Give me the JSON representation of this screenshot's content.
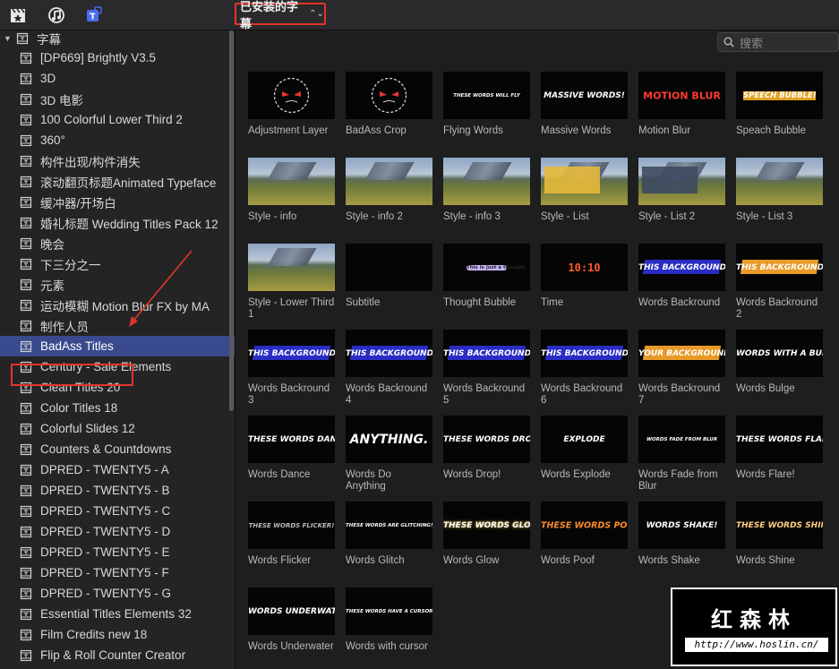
{
  "toolbar": {
    "icons": [
      "clapper-icon",
      "music-note-icon",
      "titles-icon"
    ],
    "library_label": "已安装的字幕",
    "chevron": "⌃⌄"
  },
  "search": {
    "placeholder": "搜索"
  },
  "sidebar": {
    "root": "字幕",
    "items": [
      "[DP669] Brightly V3.5",
      "3D",
      "3D 电影",
      "100 Colorful Lower Third 2",
      "360°",
      "构件出现/构件消失",
      "滚动翻页标题Animated Typeface",
      "缓冲器/开场白",
      "婚礼标题 Wedding Titles Pack 12",
      "晚会",
      "下三分之一",
      "元素",
      "运动模糊 Motion Blur FX by MA",
      "制作人员",
      "BadAss Titles",
      "Century - Sale Elements",
      "Clean Titles 20",
      "Color Titles 18",
      "Colorful Slides 12",
      "Counters & Countdowns",
      "DPRED - TWENTY5 - A",
      "DPRED - TWENTY5 - B",
      "DPRED - TWENTY5 - C",
      "DPRED - TWENTY5 - D",
      "DPRED - TWENTY5 - E",
      "DPRED - TWENTY5 - F",
      "DPRED - TWENTY5 - G",
      "Essential Titles Elements 32",
      "Film Credits new 18",
      "Flip & Roll Counter Creator"
    ],
    "selected_index": 14
  },
  "grid": {
    "items": [
      {
        "label": "Adjustment Layer",
        "thumb": ""
      },
      {
        "label": "BadAss Crop",
        "thumb": ""
      },
      {
        "label": "Flying Words",
        "thumb": "THESE  WORDS  WILL  FLY"
      },
      {
        "label": "Massive Words",
        "thumb": "MASSIVE WORDS!"
      },
      {
        "label": "Motion Blur",
        "thumb": "MOTION BLUR"
      },
      {
        "label": "Speach Bubble",
        "thumb": "SPEECH BUBBLE!"
      },
      {
        "label": "Style - info",
        "thumb": ""
      },
      {
        "label": "Style - info 2",
        "thumb": ""
      },
      {
        "label": "Style - info 3",
        "thumb": ""
      },
      {
        "label": "Style - List",
        "thumb": ""
      },
      {
        "label": "Style - List 2",
        "thumb": ""
      },
      {
        "label": "Style - List 3",
        "thumb": ""
      },
      {
        "label": "Style - Lower Third 1",
        "thumb": ""
      },
      {
        "label": "Subtitle",
        "thumb": ""
      },
      {
        "label": "Thought Bubble",
        "thumb": "This is just a thought"
      },
      {
        "label": "Time",
        "thumb": "10:10"
      },
      {
        "label": "Words Backround",
        "thumb": "THIS BACKGROUND"
      },
      {
        "label": "Words Backround 2",
        "thumb": "THIS BACKGROUND"
      },
      {
        "label": "Words Backround 3",
        "thumb": "THIS BACKGROUND"
      },
      {
        "label": "Words Backround 4",
        "thumb": "THIS BACKGROUNDS"
      },
      {
        "label": "Words Backround 5",
        "thumb": "THIS BACKGROUND"
      },
      {
        "label": "Words Backround 6",
        "thumb": "THIS BACKGROUND"
      },
      {
        "label": "Words Backround 7",
        "thumb": "YOUR BACKGROUND"
      },
      {
        "label": "Words Bulge",
        "thumb": "WORDS WITH A BUMP"
      },
      {
        "label": "Words Dance",
        "thumb": "THESE WORDS DANCE!"
      },
      {
        "label": "Words Do Anything",
        "thumb": "ANYTHING."
      },
      {
        "label": "Words Drop!",
        "thumb": "THESE WORDS DROP!"
      },
      {
        "label": "Words Explode",
        "thumb": "EXPLODE"
      },
      {
        "label": "Words Fade from Blur",
        "thumb": "WORDS FADE FROM BLUR"
      },
      {
        "label": "Words Flare!",
        "thumb": "THESE WORDS FLARE"
      },
      {
        "label": "Words Flicker",
        "thumb": "THESE WORDS FLICKER!"
      },
      {
        "label": "Words Glitch",
        "thumb": "THESE WORDS ARE GLITCHING!"
      },
      {
        "label": "Words Glow",
        "thumb": "THESE WORDS GLOW!"
      },
      {
        "label": "Words Poof",
        "thumb": "THESE WORDS POOF!"
      },
      {
        "label": "Words Shake",
        "thumb": "WORDS SHAKE!"
      },
      {
        "label": "Words Shine",
        "thumb": "THESE WORDS SHINE!"
      },
      {
        "label": "Words Underwater",
        "thumb": "WORDS UNDERWATER"
      },
      {
        "label": "Words with cursor",
        "thumb": "THESE WORDS HAVE A CURSOR"
      }
    ]
  },
  "watermark": {
    "title": "红森林",
    "url": "http://www.hoslin.cn/"
  },
  "colors": {
    "accent": "#e0352b",
    "selection": "#3a4a8e",
    "band": "#2a2dc4"
  }
}
